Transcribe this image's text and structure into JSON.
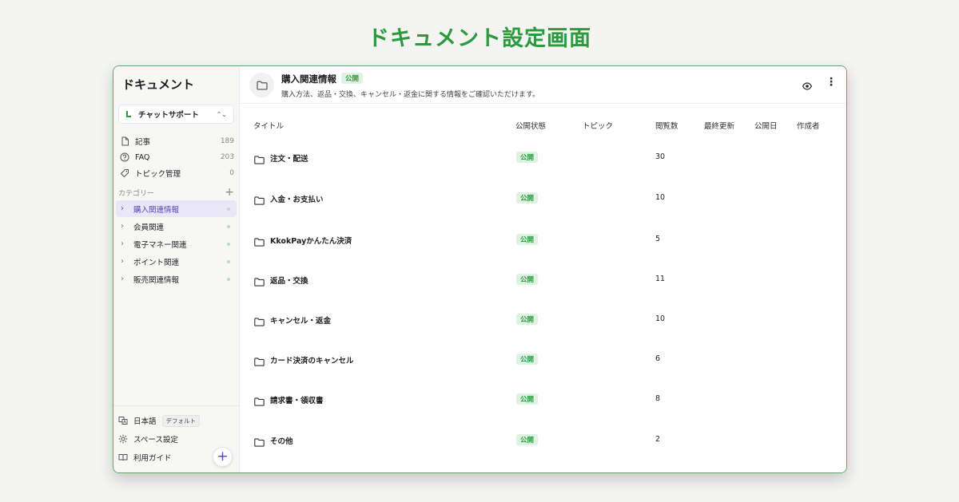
{
  "banner": {
    "title": "ドキュメント設定画面"
  },
  "sidebar": {
    "title": "ドキュメント",
    "space": {
      "label": "チャットサポート"
    },
    "nav": [
      {
        "label": "記事",
        "count": "189",
        "icon": "file-icon"
      },
      {
        "label": "FAQ",
        "count": "203",
        "icon": "question-icon"
      },
      {
        "label": "トピック管理",
        "count": "0",
        "icon": "tag-icon"
      }
    ],
    "category_header": "カテゴリー",
    "categories": [
      {
        "label": "購入関連情報",
        "active": true
      },
      {
        "label": "会員関連",
        "active": false
      },
      {
        "label": "電子マネー関連",
        "active": false
      },
      {
        "label": "ポイント関連",
        "active": false
      },
      {
        "label": "販売関連情報",
        "active": false
      }
    ],
    "bottom": {
      "language": "日本語",
      "language_badge": "デフォルト",
      "space_settings": "スペース設定",
      "guide": "利用ガイド"
    }
  },
  "main": {
    "header": {
      "title": "購入関連情報",
      "badge": "公開",
      "description": "購入方法、返品・交換、キャンセル・返金に関する情報をご確認いただけます。"
    },
    "columns": [
      "タイトル",
      "公開状態",
      "トピック",
      "閲覧数",
      "最終更新",
      "公開日",
      "作成者"
    ],
    "rows": [
      {
        "title": "注文・配送",
        "status": "公開",
        "views": "30"
      },
      {
        "title": "入金・お支払い",
        "status": "公開",
        "views": "10"
      },
      {
        "title": "KkokPayかんたん決済",
        "status": "公開",
        "views": "5"
      },
      {
        "title": "返品・交換",
        "status": "公開",
        "views": "11"
      },
      {
        "title": "キャンセル・返金",
        "status": "公開",
        "views": "10"
      },
      {
        "title": "カード決済のキャンセル",
        "status": "公開",
        "views": "6"
      },
      {
        "title": "請求書・領収書",
        "status": "公開",
        "views": "8"
      },
      {
        "title": "その他",
        "status": "公開",
        "views": "2"
      }
    ]
  },
  "colors": {
    "accent_green": "#2e9a3e",
    "accent_purple": "#5746b3",
    "badge_bg": "#dff3e2"
  }
}
